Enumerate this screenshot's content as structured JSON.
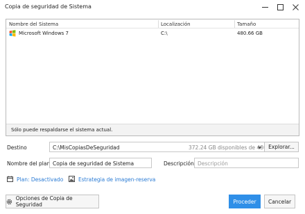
{
  "window": {
    "title": "Copia de seguridad de Sistema",
    "minimize_symbol": "—",
    "maximize_symbol": "☐",
    "close_symbol": "✕"
  },
  "table": {
    "columns": [
      "Nombre del Sistema",
      "Localización",
      "Tamaño"
    ],
    "rows": [
      {
        "icon": "windows-logo-icon",
        "name": "Microsoft Windows 7",
        "location": "C:\\",
        "size": "480.66 GB"
      }
    ],
    "note": "Sólo puede respaldarse el sistema actual."
  },
  "destination": {
    "label": "Destino",
    "path": "C:\\MisCopiasDeSeguridad",
    "space": "372.24 GB disponibles de 480.66 GB",
    "browse_label": "Explorar..."
  },
  "plan": {
    "label": "Nombre del plan",
    "value": "Copia de seguridad de Sistema",
    "description_label": "Descripción",
    "description_placeholder": "Descripción"
  },
  "links": {
    "schedule": "Plan: Desactivado",
    "strategy": "Estrategia de imagen-reserva"
  },
  "buttons": {
    "options": "Opciones de Copia de Seguridad",
    "proceed": "Proceder",
    "cancel": "Cancelar"
  },
  "colors": {
    "accent": "#2f8fe8",
    "link": "#2a7bd4"
  }
}
